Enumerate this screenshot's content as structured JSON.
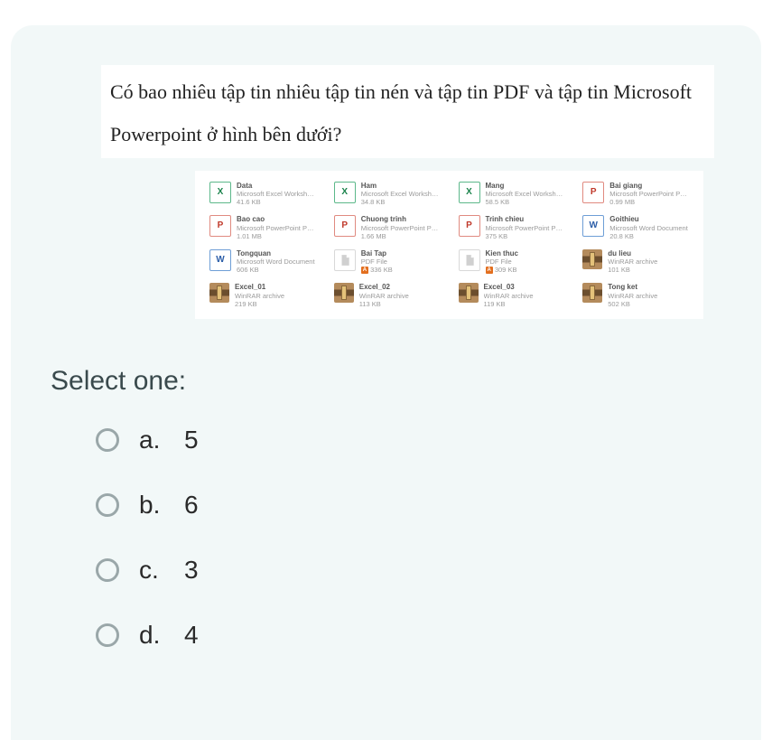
{
  "question": "Có bao nhiêu tập tin nhiêu tập tin nén và tập tin PDF và tập tin Microsoft Powerpoint ở hình bên dưới?",
  "select_one": "Select one:",
  "files": [
    {
      "name": "Data",
      "type": "Microsoft Excel Worksheet",
      "size": "41.6 KB",
      "icon": "xls"
    },
    {
      "name": "Ham",
      "type": "Microsoft Excel Worksheet",
      "size": "34.8 KB",
      "icon": "xls"
    },
    {
      "name": "Mang",
      "type": "Microsoft Excel Worksheet",
      "size": "58.5 KB",
      "icon": "xls"
    },
    {
      "name": "Bai giang",
      "type": "Microsoft PowerPoint Pres…",
      "size": "0.99 MB",
      "icon": "ppt"
    },
    {
      "name": "Bao cao",
      "type": "Microsoft PowerPoint Pres…",
      "size": "1.01 MB",
      "icon": "ppt"
    },
    {
      "name": "Chuong trinh",
      "type": "Microsoft PowerPoint Pres…",
      "size": "1.66 MB",
      "icon": "ppt"
    },
    {
      "name": "Trinh chieu",
      "type": "Microsoft PowerPoint Pres…",
      "size": "375 KB",
      "icon": "ppt"
    },
    {
      "name": "Goithieu",
      "type": "Microsoft Word Document",
      "size": "20.8 KB",
      "icon": "doc"
    },
    {
      "name": "Tongquan",
      "type": "Microsoft Word Document",
      "size": "606 KB",
      "icon": "doc"
    },
    {
      "name": "Bai Tap",
      "type": "PDF File",
      "size": "336 KB",
      "icon": "pdf"
    },
    {
      "name": "Kien thuc",
      "type": "PDF File",
      "size": "309 KB",
      "icon": "pdf"
    },
    {
      "name": "du lieu",
      "type": "WinRAR archive",
      "size": "101 KB",
      "icon": "rar"
    },
    {
      "name": "Excel_01",
      "type": "WinRAR archive",
      "size": "219 KB",
      "icon": "rar"
    },
    {
      "name": "Excel_02",
      "type": "WinRAR archive",
      "size": "113 KB",
      "icon": "rar"
    },
    {
      "name": "Excel_03",
      "type": "WinRAR archive",
      "size": "119 KB",
      "icon": "rar"
    },
    {
      "name": "Tong ket",
      "type": "WinRAR archive",
      "size": "502 KB",
      "icon": "rar"
    }
  ],
  "options": [
    {
      "letter": "a.",
      "text": "5"
    },
    {
      "letter": "b.",
      "text": "6"
    },
    {
      "letter": "c.",
      "text": "3"
    },
    {
      "letter": "d.",
      "text": "4"
    }
  ]
}
